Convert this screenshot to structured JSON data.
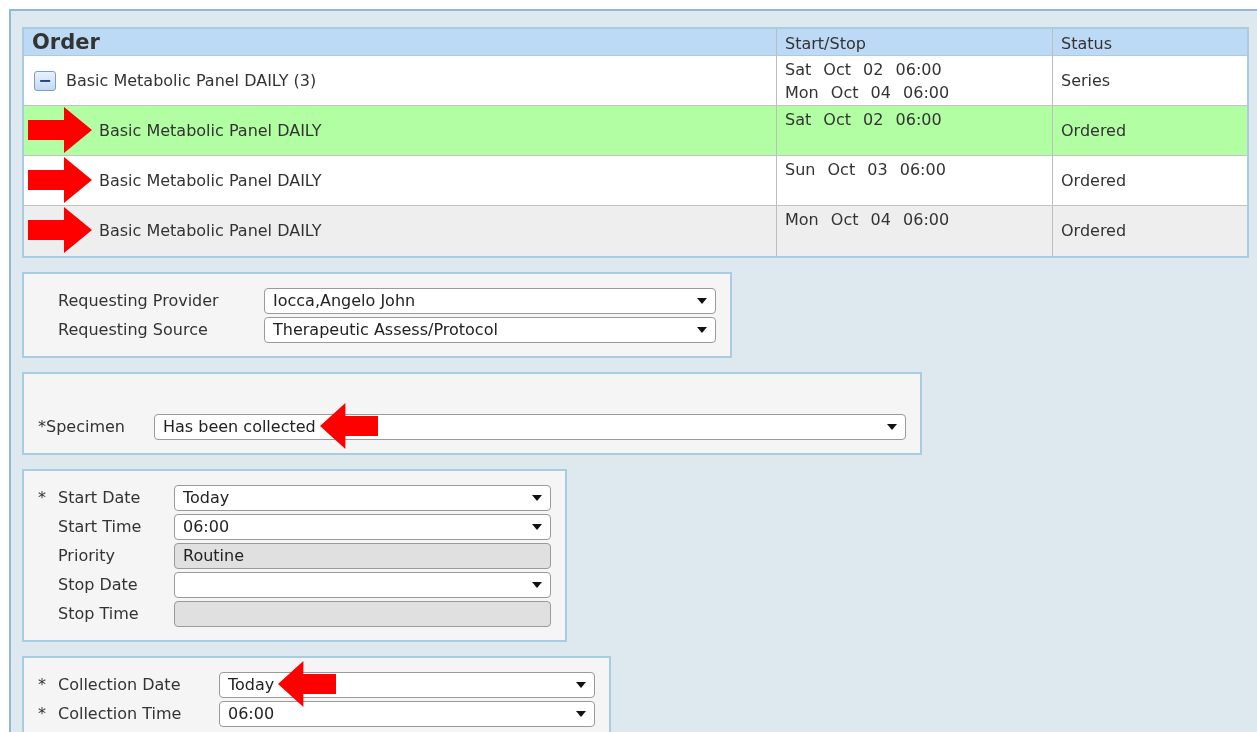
{
  "table": {
    "columns": [
      "Order",
      "Start/Stop",
      "Status"
    ],
    "rows": [
      {
        "kind": "series",
        "toggle": "−",
        "order": "Basic Metabolic Panel DAILY (3)",
        "dates": [
          "Sat Oct 02 06:00",
          "Mon Oct 04 06:00"
        ],
        "status": "Series",
        "selected": false,
        "arrow": false
      },
      {
        "kind": "item",
        "order": "Basic Metabolic Panel DAILY",
        "dates": [
          "Sat Oct 02 06:00"
        ],
        "status": "Ordered",
        "selected": true,
        "arrow": true
      },
      {
        "kind": "item",
        "order": "Basic Metabolic Panel DAILY",
        "dates": [
          "Sun Oct 03 06:00"
        ],
        "status": "Ordered",
        "selected": false,
        "arrow": true
      },
      {
        "kind": "item",
        "order": "Basic Metabolic Panel DAILY",
        "dates": [
          "Mon Oct 04 06:00"
        ],
        "status": "Ordered",
        "selected": false,
        "arrow": true
      }
    ]
  },
  "panels": [
    {
      "kind": "provider",
      "fields": [
        {
          "label": "Requesting Provider",
          "kind": "select",
          "value": "Iocca,Angelo John",
          "arrow": false
        },
        {
          "label": "Requesting Source",
          "kind": "select",
          "value": "Therapeutic Assess/Protocol",
          "arrow": false
        }
      ]
    },
    {
      "kind": "specimen",
      "fields": [
        {
          "label": "*Specimen",
          "kind": "select",
          "value": "Has been collected",
          "arrow": true
        }
      ]
    },
    {
      "kind": "dates",
      "fields": [
        {
          "mark": "*",
          "label": "Start Date",
          "kind": "select",
          "value": "Today",
          "arrow": false
        },
        {
          "label": "Start Time",
          "kind": "select",
          "value": "06:00",
          "arrow": false
        },
        {
          "label": "Priority",
          "kind": "readonly",
          "value": "Routine",
          "arrow": false
        },
        {
          "label": "Stop Date",
          "kind": "select",
          "arrow": false
        },
        {
          "label": "Stop Time",
          "kind": "readonly",
          "arrow": false
        }
      ]
    },
    {
      "kind": "collection",
      "fields": [
        {
          "mark": "*",
          "label": "Collection Date",
          "kind": "select",
          "value": "Today",
          "arrow": true
        },
        {
          "mark": "*",
          "label": "Collection Time",
          "kind": "select",
          "value": "06:00",
          "arrow": false
        }
      ]
    }
  ]
}
